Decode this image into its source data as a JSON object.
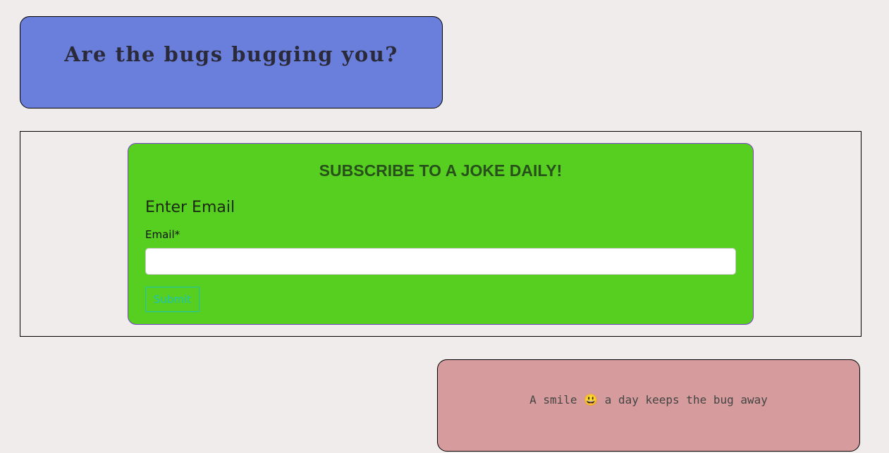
{
  "hero": {
    "title": "Are the bugs bugging you?"
  },
  "subscribe": {
    "heading": "SUBSCRIBE TO A JOKE DAILY!",
    "form_title": "Enter Email",
    "email_label": "Email*",
    "email_value": "",
    "email_placeholder": "",
    "submit_label": "Submit"
  },
  "quote": {
    "text": "A smile 😃 a day keeps the bug away"
  },
  "colors": {
    "page_bg": "#f0eceb",
    "hero_bg": "#6a7edb",
    "subscribe_bg": "#56cf20",
    "subscribe_border": "#7a3fd0",
    "submit_accent": "#1ec2b4",
    "quote_bg": "#d69b9c"
  }
}
